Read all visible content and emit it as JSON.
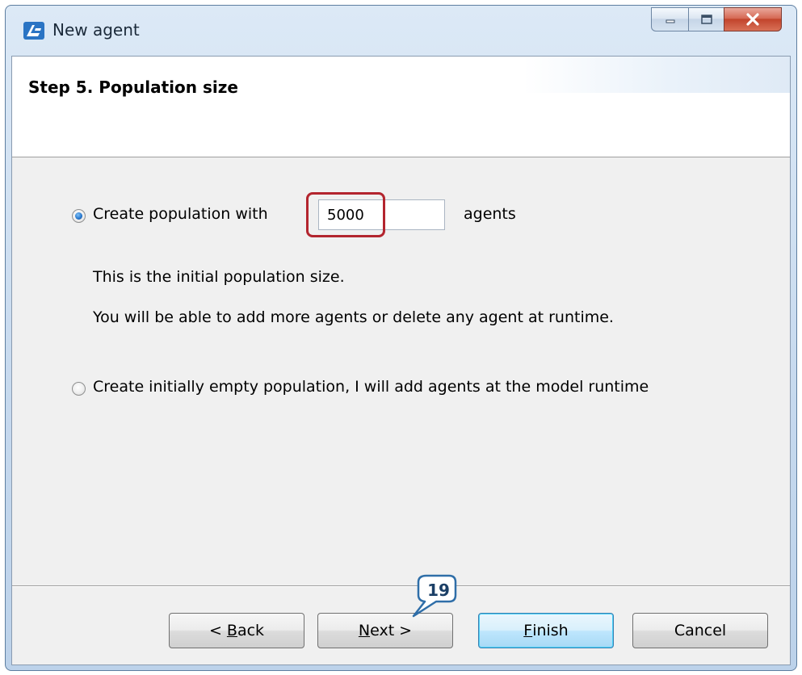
{
  "window": {
    "title": "New agent"
  },
  "wizard": {
    "step_title": "Step 5. Population size"
  },
  "options": {
    "create_population_label": "Create population with",
    "population_value": "5000",
    "agents_suffix": "agents",
    "note_initial": "This is the initial population size.",
    "note_runtime": "You will be able to add more agents or delete any agent at runtime.",
    "empty_population_label": "Create initially empty population, I will add agents at the model runtime",
    "selected": "create_population"
  },
  "buttons": {
    "back_prefix": "< ",
    "back_mnemonic": "B",
    "back_rest": "ack",
    "next_mnemonic": "N",
    "next_rest": "ext >",
    "finish_mnemonic": "F",
    "finish_rest": "inish",
    "cancel": "Cancel"
  },
  "callout": {
    "number": "19"
  },
  "colors": {
    "highlight": "#b3252e",
    "callout_border": "#2f6ea8",
    "callout_fill": "#ffffff"
  }
}
